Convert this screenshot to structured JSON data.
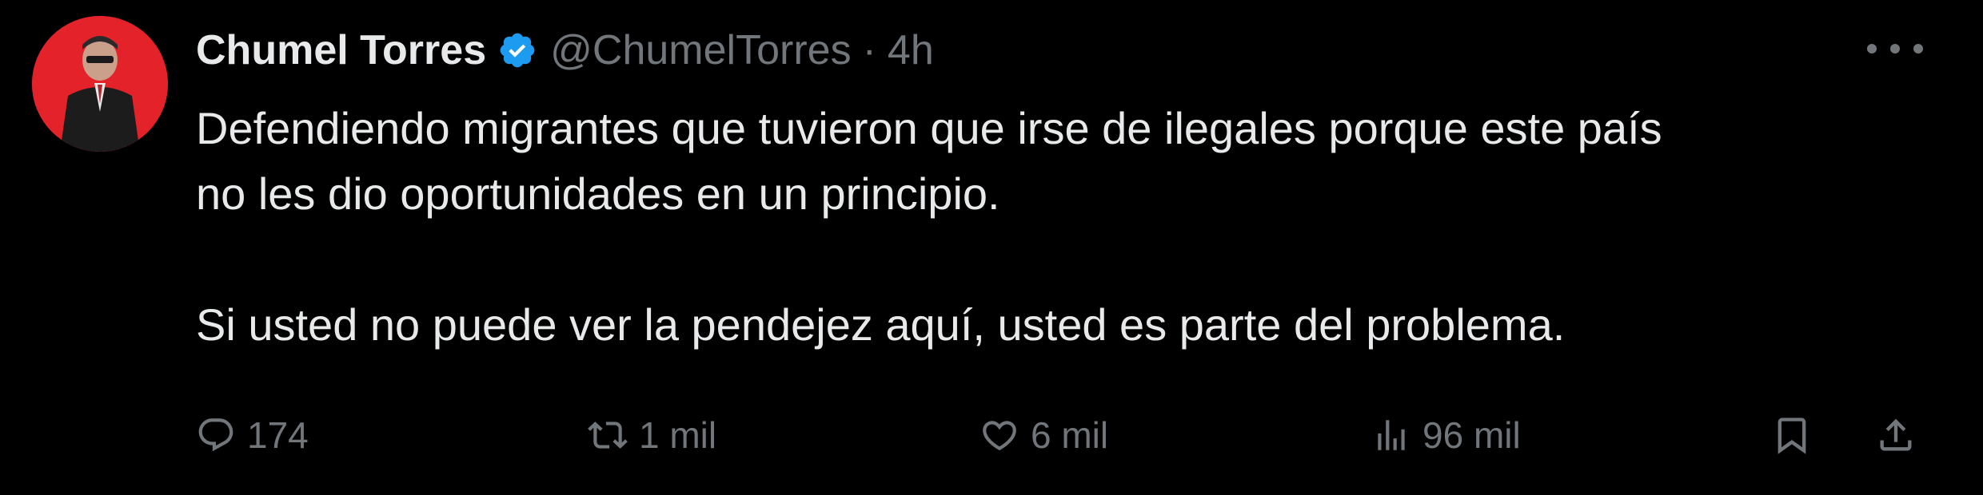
{
  "author": {
    "name": "Chumel Torres",
    "handle": "@ChumelTorres",
    "separator": "·",
    "time": "4h"
  },
  "tweet": {
    "line1": "Defendiendo migrantes que tuvieron que irse de ilegales porque este país",
    "line2": "no les dio oportunidades en un principio.",
    "line3": "Si usted no puede ver la pendejez aquí, usted es parte del problema."
  },
  "actions": {
    "replies": "174",
    "retweets": "1 mil",
    "likes": "6 mil",
    "views": "96 mil"
  },
  "icons": {
    "verified": "verified-badge-icon",
    "more": "more-icon",
    "reply": "reply-icon",
    "retweet": "retweet-icon",
    "like": "heart-icon",
    "views": "views-icon",
    "bookmark": "bookmark-icon",
    "share": "share-icon"
  },
  "colors": {
    "background": "#000000",
    "text": "#e7e9ea",
    "muted": "#71767b",
    "verified": "#1d9bf0",
    "avatar_bg": "#e3222a"
  }
}
